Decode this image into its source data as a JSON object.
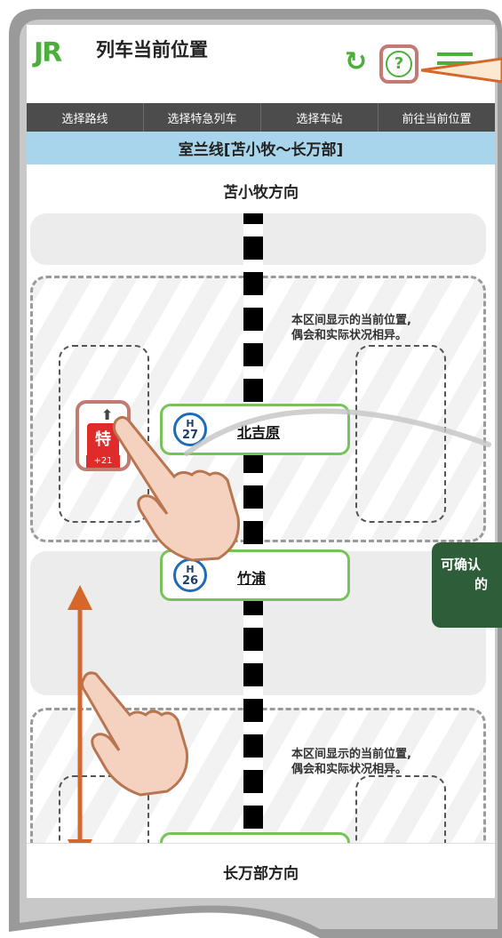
{
  "app": {
    "logo": "JR",
    "title": "列车当前位置"
  },
  "header_icons": {
    "reload": "reload-icon",
    "help": "help-icon",
    "menu": "menu-icon",
    "help_glyph": "?"
  },
  "tabs": [
    {
      "label": "选择路线"
    },
    {
      "label": "选择特急列车"
    },
    {
      "label": "选择车站"
    },
    {
      "label": "前往当前位置"
    }
  ],
  "line": {
    "name": "室兰线[苫小牧～长万部]"
  },
  "directions": {
    "top": "苫小牧方向",
    "bottom": "长万部方向"
  },
  "sections": [
    {
      "notice_line1": "本区间显示的当前位置,",
      "notice_line2": "偶会和实际状况相异。"
    },
    {
      "notice_line1": "本区间显示的当前位置,",
      "notice_line2": "偶会和实际状况相异。"
    }
  ],
  "stations": [
    {
      "badge_letter": "H",
      "badge_number": "27",
      "name": "北吉原"
    },
    {
      "badge_letter": "H",
      "badge_number": "26",
      "name": "竹浦"
    }
  ],
  "train": {
    "type_label": "特",
    "delay": "+21",
    "arrow": "⬆"
  },
  "callout": {
    "line1": "可确认",
    "line2": "的"
  },
  "colors": {
    "brand_green": "#4caf3b",
    "train_red": "#e02b2b",
    "highlight": "#c27a72",
    "line_blue": "#a9d5ec",
    "callout_green": "#2e5d3a"
  }
}
